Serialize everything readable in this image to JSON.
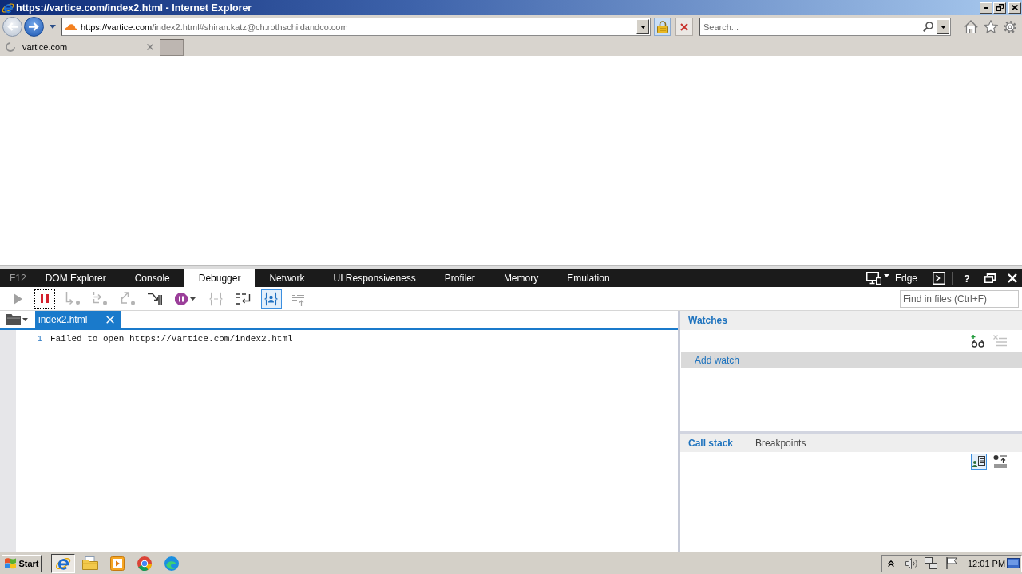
{
  "window": {
    "title": "https://vartice.com/index2.html - Internet Explorer"
  },
  "address_bar": {
    "host": "https://vartice.com",
    "path": "/index2.html#shiran.katz@ch.rothschildandco.com"
  },
  "search": {
    "placeholder": "Search..."
  },
  "browser_tabs": [
    {
      "label": "vartice.com",
      "selected": true,
      "loading": true
    }
  ],
  "devtools": {
    "label": "F12",
    "tabs": [
      {
        "label": "DOM Explorer",
        "selected": false
      },
      {
        "label": "Console",
        "selected": false
      },
      {
        "label": "Debugger",
        "selected": true
      },
      {
        "label": "Network",
        "selected": false
      },
      {
        "label": "UI Responsiveness",
        "selected": false
      },
      {
        "label": "Profiler",
        "selected": false
      },
      {
        "label": "Memory",
        "selected": false
      },
      {
        "label": "Emulation",
        "selected": false
      }
    ],
    "mode": "Edge",
    "help": "?",
    "toolbar": [
      {
        "disabled": true,
        "pressed": false,
        "focused": false
      },
      {
        "disabled": false,
        "pressed": false,
        "focused": true
      },
      {
        "disabled": true,
        "pressed": false,
        "focused": false
      },
      {
        "disabled": true,
        "pressed": false,
        "focused": false
      },
      {
        "disabled": true,
        "pressed": false,
        "focused": false
      },
      {
        "disabled": false,
        "pressed": false,
        "focused": false
      },
      {
        "disabled": false,
        "pressed": false,
        "focused": false
      },
      {
        "disabled": true,
        "pressed": false,
        "focused": false
      },
      {
        "disabled": false,
        "pressed": false,
        "focused": false
      },
      {
        "disabled": false,
        "pressed": true,
        "focused": false
      },
      {
        "disabled": true,
        "pressed": false,
        "focused": false
      }
    ],
    "find": {
      "placeholder": "Find in files (Ctrl+F)"
    },
    "file_tabs": [
      {
        "label": "index2.html",
        "selected": true
      }
    ],
    "code_lines": [
      {
        "number": "1",
        "text": "Failed to open https://vartice.com/index2.html"
      }
    ],
    "watches": {
      "title": "Watches",
      "add_label": "Add watch",
      "tools": [
        {
          "disabled": false
        },
        {
          "disabled": true
        }
      ]
    },
    "panel_tabs": [
      {
        "label": "Call stack",
        "selected": true
      },
      {
        "label": "Breakpoints",
        "selected": false
      }
    ],
    "panel_toolbar": [
      {
        "pressed": true
      },
      {
        "pressed": false
      }
    ]
  },
  "taskbar": {
    "start": "Start",
    "apps": [
      {
        "selected": true
      },
      {
        "selected": false
      },
      {
        "selected": false
      },
      {
        "selected": false
      },
      {
        "selected": false
      }
    ],
    "clock": "12:01 PM"
  }
}
